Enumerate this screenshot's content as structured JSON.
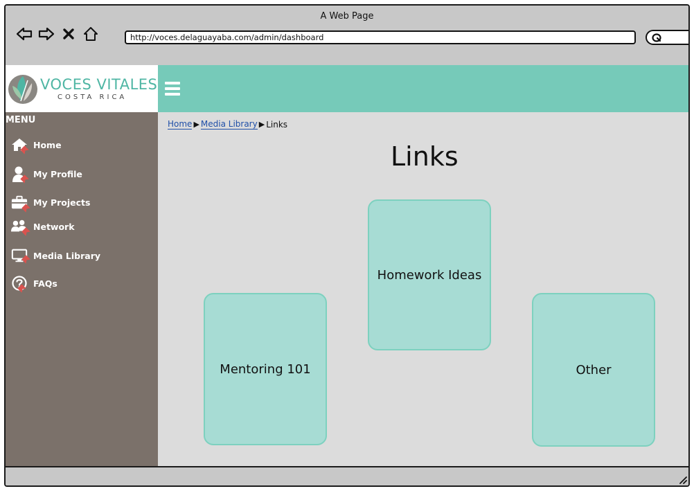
{
  "window": {
    "title": "A Web Page",
    "url": "http://voces.delaguayaba.com/admin/dashboard"
  },
  "brand": {
    "name": "VOCES VITALES",
    "tagline": "COSTA RICA",
    "accent_color": "#76cab9",
    "logo_text_color": "#4fb6a4"
  },
  "sidebar": {
    "title": "MENU",
    "items": [
      {
        "label": "Home",
        "icon": "home-icon"
      },
      {
        "label": "My Profile",
        "icon": "user-icon"
      },
      {
        "label": "My Projects",
        "icon": "briefcase-icon"
      },
      {
        "label": "Network",
        "icon": "people-icon"
      },
      {
        "label": "Media Library",
        "icon": "monitor-icon"
      },
      {
        "label": "FAQs",
        "icon": "question-icon"
      }
    ]
  },
  "breadcrumb": {
    "items": [
      "Home",
      "Media Library",
      "Links"
    ]
  },
  "page": {
    "title": "Links"
  },
  "cards": [
    {
      "label": "Homework Ideas"
    },
    {
      "label": "Mentoring 101"
    },
    {
      "label": "Other"
    }
  ]
}
